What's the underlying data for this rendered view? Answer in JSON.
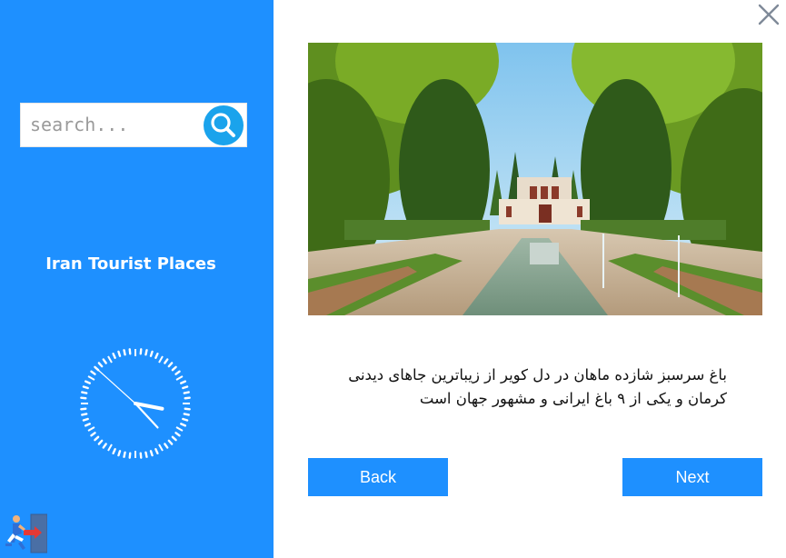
{
  "sidebar": {
    "search": {
      "placeholder": "search...",
      "value": ""
    },
    "app_title": "Iran Tourist Places",
    "clock": {
      "hour": 3,
      "minute": 22,
      "second": 52
    }
  },
  "main": {
    "description": "باغ سرسبز شازده ماهان در دل کویر از زیباترین جاهای دیدنی کرمان و یکی از ۹ باغ ایرانی و مشهور جهان است",
    "back_label": "Back",
    "next_label": "Next"
  },
  "colors": {
    "sidebar_bg": "#1e90ff",
    "button_bg": "#1e90ff",
    "search_button": "#1aa3ec"
  },
  "icons": {
    "search": "search-icon",
    "close": "close-icon",
    "exit": "exit-icon",
    "clock": "clock-icon"
  }
}
